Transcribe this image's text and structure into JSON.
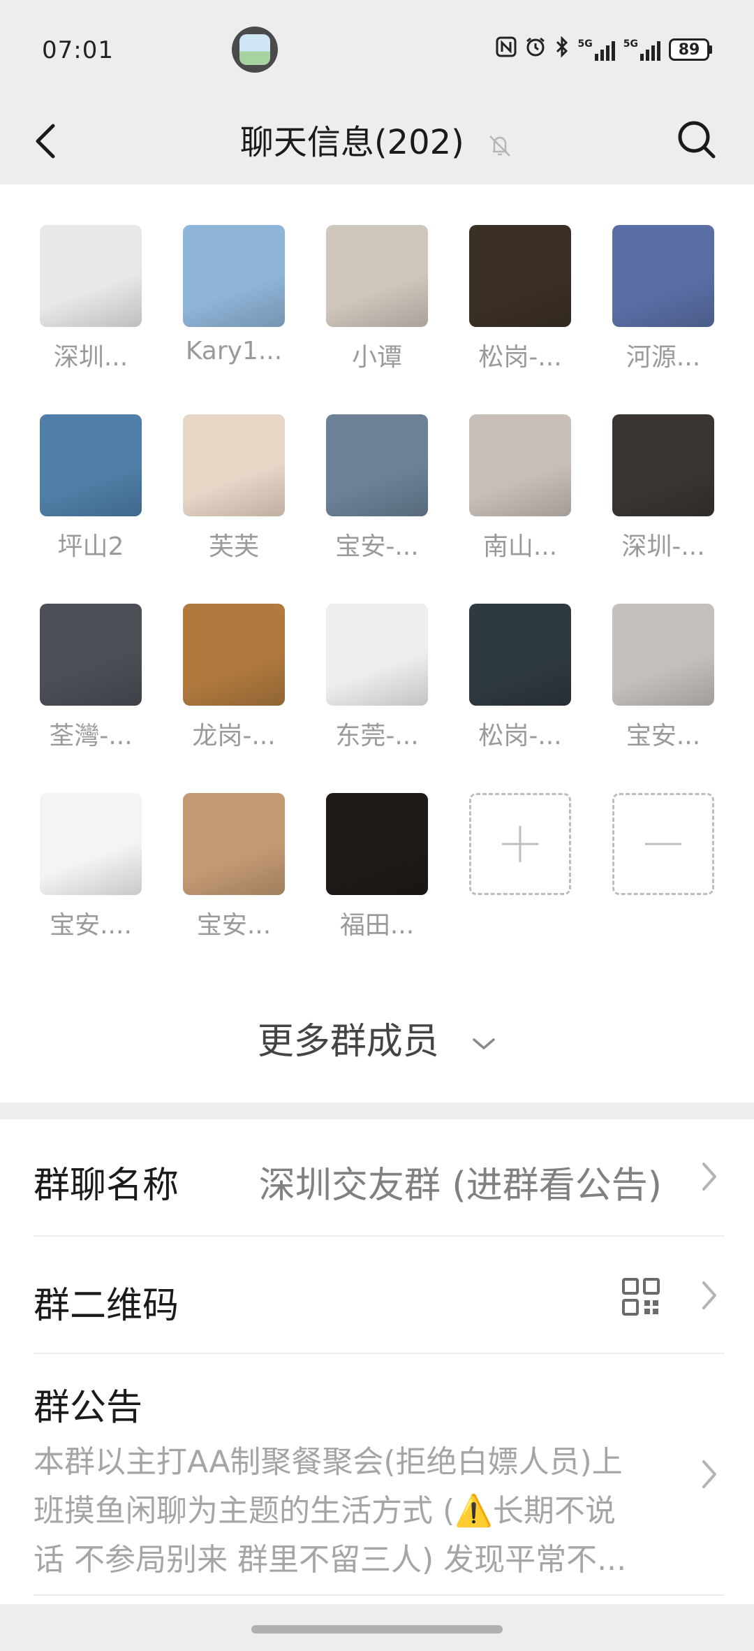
{
  "status_bar": {
    "time": "07:01",
    "icons": [
      "nfc-icon",
      "alarm-icon",
      "bluetooth-icon"
    ],
    "signal1_label": "5G",
    "signal2_label": "5G",
    "battery": "89"
  },
  "nav": {
    "title": "聊天信息(202)",
    "back_icon": "chevron-left-icon",
    "mute_icon": "bell-off-icon",
    "search_icon": "search-icon"
  },
  "members": [
    {
      "name": "深圳..."
    },
    {
      "name": "Kary1..."
    },
    {
      "name": "小谭"
    },
    {
      "name": "松岗-..."
    },
    {
      "name": "河源..."
    },
    {
      "name": "坪山2"
    },
    {
      "name": "芙芙"
    },
    {
      "name": "宝安-..."
    },
    {
      "name": "南山..."
    },
    {
      "name": "深圳-..."
    },
    {
      "name": "荃灣-..."
    },
    {
      "name": "龙岗-..."
    },
    {
      "name": "东莞-..."
    },
    {
      "name": "松岗-..."
    },
    {
      "name": "宝安..."
    },
    {
      "name": "宝安...."
    },
    {
      "name": "宝安..."
    },
    {
      "name": "福田..."
    }
  ],
  "avatar_colors": [
    "#e8e8e8",
    "#8fb5d8",
    "#cfc6bd",
    "#3b3026",
    "#5a6fa6",
    "#4f7fa8",
    "#e8d6c7",
    "#6c8198",
    "#c7bfb8",
    "#3a3532",
    "#4b4f55",
    "#b07a3f",
    "#eeeeee",
    "#2f3940",
    "#c4c1bc",
    "#f4f4f4",
    "#c49a74",
    "#1e1a18"
  ],
  "add_member": {
    "icon": "plus-icon"
  },
  "remove_member": {
    "icon": "minus-icon"
  },
  "more_members": {
    "label": "更多群成员",
    "icon": "chevron-down-icon"
  },
  "settings": {
    "group_name": {
      "label": "群聊名称",
      "value": "深圳交友群 (进群看公告)"
    },
    "group_qr": {
      "label": "群二维码",
      "icon": "qr-code-icon"
    },
    "notice": {
      "label": "群公告",
      "text_line1": "本群以主打AA制聚餐聚会(拒绝白嫖人员)上",
      "text_line2": "班摸鱼闲聊为主题的生活方式 (⚠️长期不说",
      "text_line3": "话 不参局别来 群里不留三人) 发现平常不..."
    }
  }
}
